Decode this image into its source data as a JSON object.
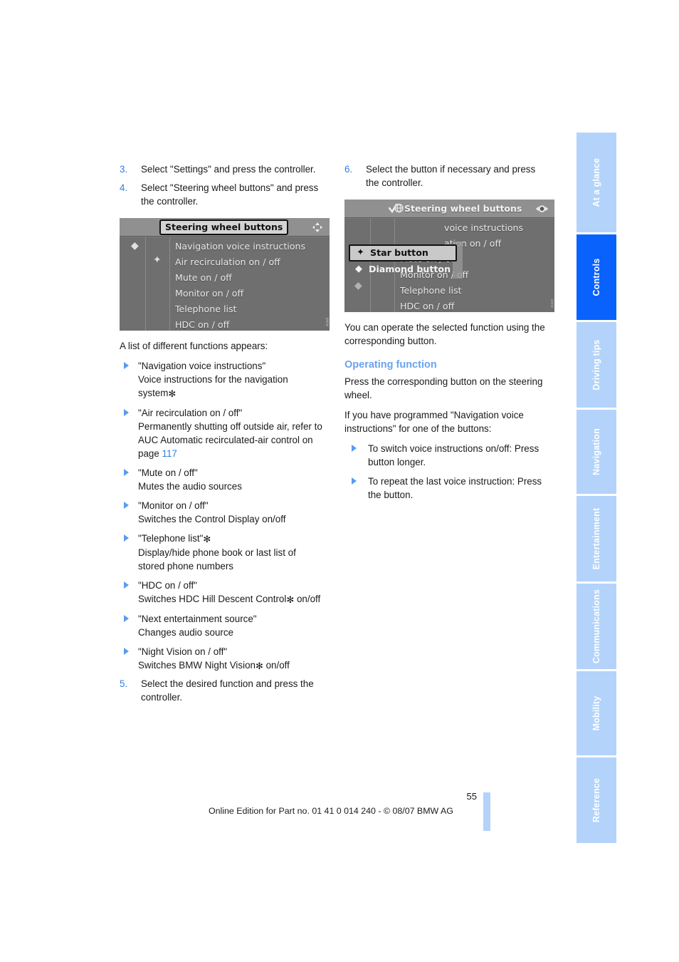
{
  "sidebar": {
    "tabs": [
      {
        "label": "At a glance",
        "active": false
      },
      {
        "label": "Controls",
        "active": true
      },
      {
        "label": "Driving tips",
        "active": false
      },
      {
        "label": "Navigation",
        "active": false
      },
      {
        "label": "Entertainment",
        "active": false
      },
      {
        "label": "Communications",
        "active": false
      },
      {
        "label": "Mobility",
        "active": false
      },
      {
        "label": "Reference",
        "active": false
      }
    ],
    "active_color": "#0a62fd",
    "inactive_color": "#b3d3fb"
  },
  "left_column": {
    "steps": [
      {
        "num": "3.",
        "text": "Select \"Settings\" and press the controller."
      },
      {
        "num": "4.",
        "text": "Select \"Steering wheel buttons\" and press the controller."
      }
    ],
    "screenshot": {
      "title": "Steering wheel buttons",
      "corner_icon": "updown-arrows-icon",
      "rows": [
        "Navigation voice instructions",
        "Air recirculation on / off",
        "Mute on / off",
        "Monitor on / off",
        "Telephone list",
        "HDC on / off"
      ],
      "diamond_glyph": "◆",
      "star_glyph": "✦"
    },
    "intro": "A list of different functions appears:",
    "functions": [
      {
        "title": "\"Navigation voice instructions\"",
        "desc": "Voice instructions for the navigation system",
        "star": true
      },
      {
        "title": "\"Air recirculation on / off\"",
        "desc": "Permanently shutting off outside air, refer to AUC Automatic recirculated-air control on page ",
        "ref": "117",
        "star": false
      },
      {
        "title": "\"Mute on / off\"",
        "desc": "Mutes the audio sources",
        "star": false
      },
      {
        "title": "\"Monitor on / off\"",
        "desc": "Switches the Control Display on/off",
        "star": false
      },
      {
        "title": "\"Telephone list\"",
        "title_star": true,
        "desc": "Display/hide phone book or last list of stored phone numbers",
        "star": false
      },
      {
        "title": "\"HDC on / off\"",
        "desc_pre": "Switches HDC Hill Descent Control",
        "desc_post": " on/off",
        "star": true
      },
      {
        "title": "\"Next entertainment source\"",
        "desc": "Changes audio source",
        "star": false
      },
      {
        "title": "\"Night Vision on / off\"",
        "desc_pre": "Switches BMW Night Vision",
        "desc_post": " on/off",
        "star": true
      }
    ],
    "step5": {
      "num": "5.",
      "text": "Select the desired function and press the controller."
    }
  },
  "right_column": {
    "step6": {
      "num": "6.",
      "text": "Select the button if necessary and press the controller."
    },
    "screenshot": {
      "title": "Steering wheel buttons",
      "left_icon": "check-globe-icon",
      "corner_icon": "leftright-arrows-icon",
      "popup_items": [
        {
          "label": "Star button",
          "glyph": "✦",
          "selected": true
        },
        {
          "label": "Diamond button",
          "glyph": "◆",
          "selected": false
        }
      ],
      "rows": [
        "voice instructions",
        "ation on / off",
        "Mute on / off",
        "Monitor on / off",
        "Telephone list",
        "HDC on / off"
      ]
    },
    "after_shot": "You can operate the selected function using the corresponding button.",
    "section_title": "Operating function",
    "p1": "Press the corresponding button on the steering wheel.",
    "p2": "If you have programmed \"Navigation voice instructions\" for one of the buttons:",
    "bullets": [
      "To switch voice instructions on/off: Press button longer.",
      "To repeat the last voice instruction: Press the button."
    ]
  },
  "footer": {
    "page_number": "55",
    "text": "Online Edition for Part no. 01 41 0 014 240 - © 08/07 BMW AG"
  }
}
